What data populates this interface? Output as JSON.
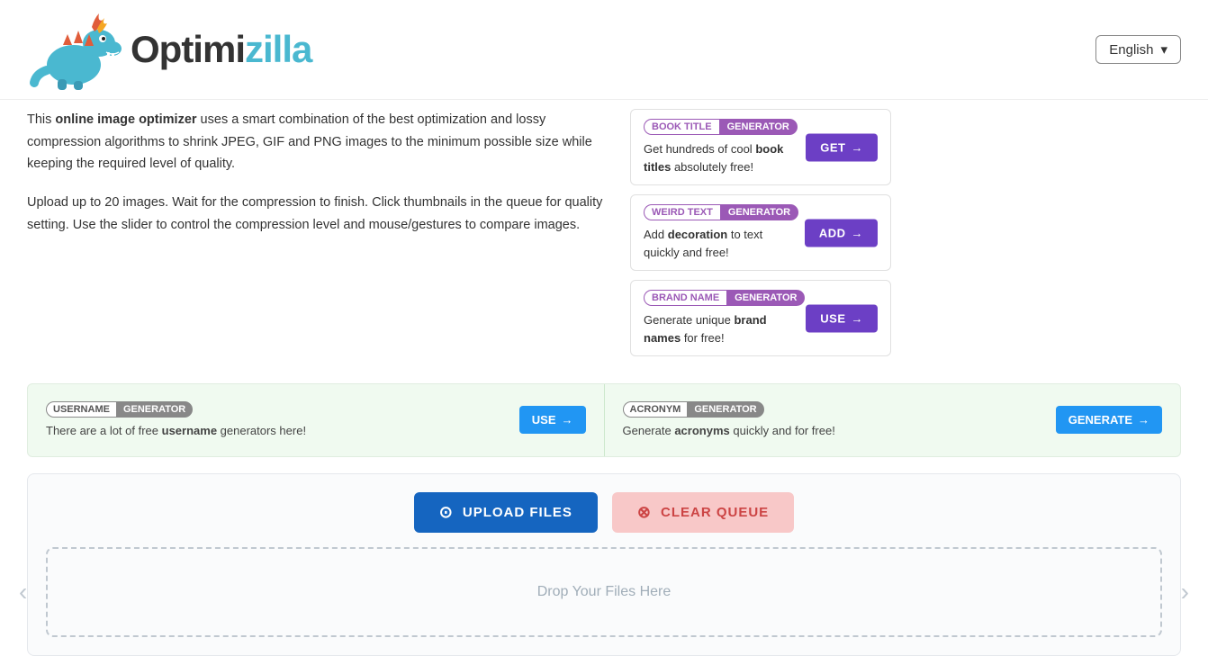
{
  "header": {
    "logo_text_left": "Optimi",
    "logo_text_right": "zilla",
    "language": "English"
  },
  "description": {
    "line1_pre": "This ",
    "line1_bold": "online image optimizer",
    "line1_post": " uses a smart combination of the best optimization and lossy compression algorithms to shrink JPEG, GIF and PNG images to the minimum possible size while keeping the required level of quality.",
    "line2": "Upload up to 20 images. Wait for the compression to finish. Click thumbnails in the queue for quality setting. Use the slider to control the compression level and mouse/gestures to compare images."
  },
  "sidebar": {
    "cards": [
      {
        "tag_left": "BOOK TITLE",
        "tag_right": "GENERATOR",
        "desc_pre": "Get hundreds of cool ",
        "desc_bold": "book titles",
        "desc_post": " absolutely free!",
        "btn_label": "GET",
        "btn_arrow": "→"
      },
      {
        "tag_left": "WEIRD TEXT",
        "tag_right": "GENERATOR",
        "desc_pre": "Add ",
        "desc_bold": "decoration",
        "desc_post": " to text quickly and free!",
        "btn_label": "ADD",
        "btn_arrow": "→"
      },
      {
        "tag_left": "BRAND NAME",
        "tag_right": "GENERATOR",
        "desc_pre": "Generate unique ",
        "desc_bold": "brand names",
        "desc_post": " for free!",
        "btn_label": "USE",
        "btn_arrow": "→"
      }
    ]
  },
  "banner": {
    "items": [
      {
        "tag_left": "USERNAME",
        "tag_right": "GENERATOR",
        "desc_pre": "There are a lot of free ",
        "desc_bold": "username",
        "desc_post": " generators here!",
        "btn_label": "USE",
        "btn_arrow": "→",
        "btn_color": "#2196F3"
      },
      {
        "tag_left": "ACRONYM",
        "tag_right": "GENERATOR",
        "desc_pre": "Generate ",
        "desc_bold": "acronyms",
        "desc_post": " quickly and for free!",
        "btn_label": "GENERATE",
        "btn_arrow": "→",
        "btn_color": "#2196F3"
      }
    ]
  },
  "upload": {
    "upload_btn": "UPLOAD FILES",
    "clear_btn": "CLEAR QUEUE",
    "drop_text": "Drop Your Files Here",
    "arrow_left": "‹",
    "arrow_right": "›"
  }
}
